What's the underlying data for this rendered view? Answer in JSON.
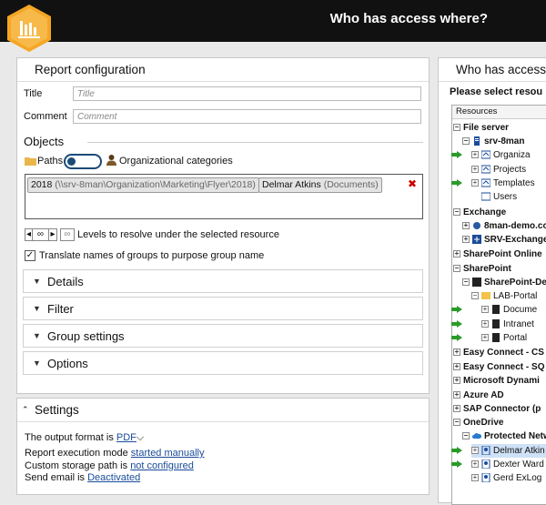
{
  "header": {
    "title": "Who has access where?"
  },
  "report": {
    "title": "Report configuration",
    "title_label": "Title",
    "title_placeholder": "Title",
    "comment_label": "Comment",
    "comment_placeholder": "Comment",
    "objects_label": "Objects",
    "paths_label": "Paths",
    "org_label": "Organizational categories",
    "tag1_main": "2018",
    "tag1_path": "(\\\\srv-8man\\Organization\\Marketing\\Flyer\\2018)",
    "tag2_main": "Delmar Atkins",
    "tag2_sub": "(Documents)",
    "levels_value": "∞",
    "levels_label": "Levels to resolve under the selected resource",
    "translate_label": "Translate names of groups to purpose group name",
    "sections": [
      "Details",
      "Filter",
      "Group settings",
      "Options"
    ]
  },
  "settings": {
    "title": "Settings",
    "output_label": "The output format is",
    "output_value": "PDF",
    "exec_label": "Report execution mode",
    "exec_value": "started manually",
    "storage_label": "Custom storage path is",
    "storage_value": "not configured",
    "email_label": "Send email is",
    "email_value": "Deactivated"
  },
  "who": {
    "title": "Who has access",
    "subtitle": "Please select resou",
    "tree_header": "Resources",
    "rows": [
      "File server",
      "srv-8man",
      "Organiza",
      "Projects",
      "Templates",
      "Users",
      "Exchange",
      "8man-demo.co",
      "SRV-Exchange",
      "SharePoint Online",
      "SharePoint",
      "SharePoint-De",
      "LAB-Portal",
      "Docume",
      "Intranet",
      "Portal",
      "Easy Connect - CS",
      "Easy Connect - SQ",
      "Microsoft Dynami",
      "Azure AD",
      "SAP Connector (p",
      "OneDrive",
      "Protected Netw",
      "Delmar Atkin",
      "Dexter Ward",
      "Gerd ExLog"
    ]
  },
  "colors": {
    "accent": "#f5a623",
    "header_bg": "#111111",
    "link": "#1a4b9a",
    "arrow": "#2a9a2a"
  }
}
